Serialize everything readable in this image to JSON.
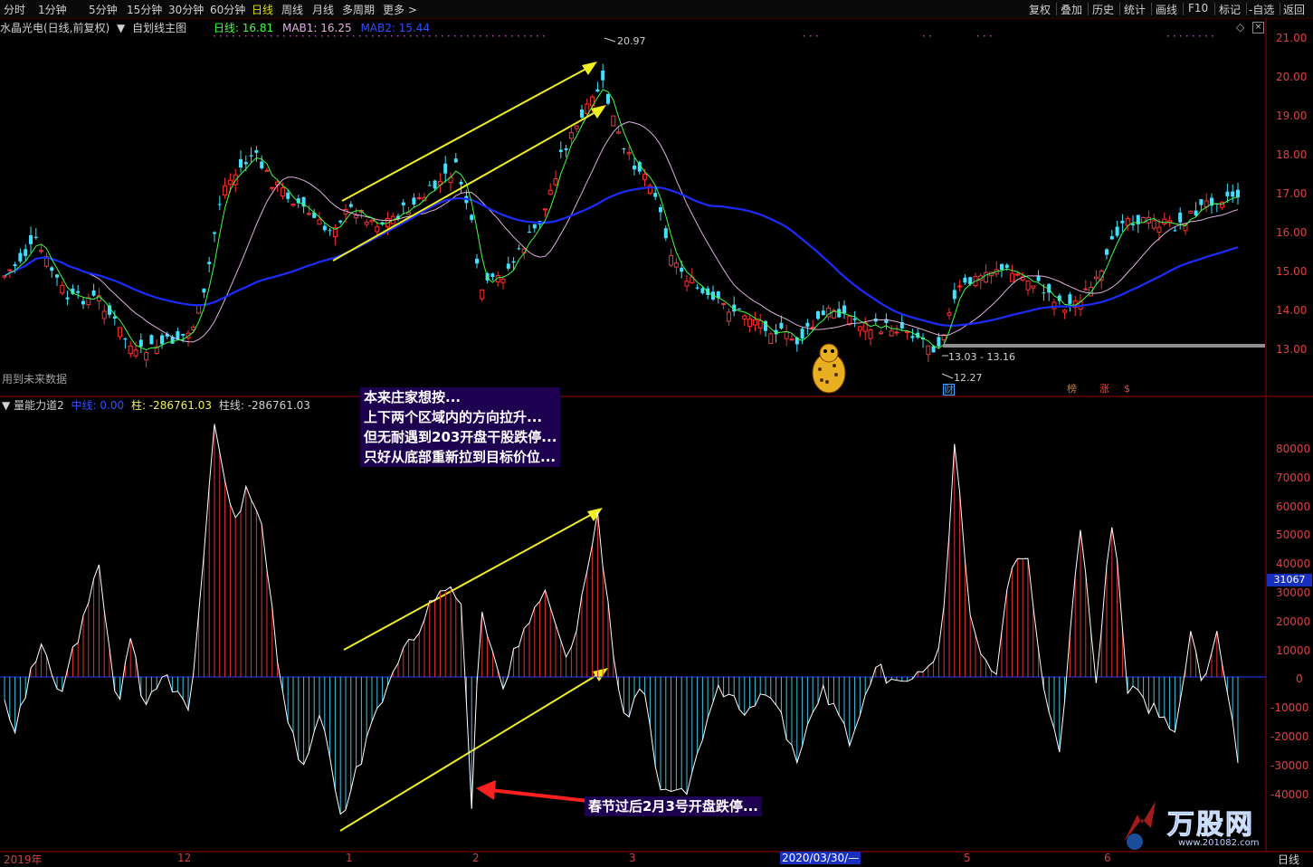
{
  "toolbar": {
    "periods": [
      "分时",
      "1分钟",
      "5分钟",
      "15分钟",
      "30分钟",
      "60分钟",
      "日线",
      "周线",
      "月线",
      "多周期",
      "更多 >"
    ],
    "active_index": 6,
    "right_buttons": [
      "复权",
      "叠加",
      "历史",
      "统计",
      "画线",
      "F10",
      "标记",
      "-自选",
      "返回"
    ]
  },
  "main_chart": {
    "stock_title": "水晶光电(日线,前复权)",
    "indicator_selector": "自划线主图",
    "legend": {
      "day_label": "日线: 16.81",
      "mab1_label": "MAB1: 16.25",
      "mab2_label": "MAB2: 15.44"
    },
    "future_data_label": "用到未来数据",
    "high_label": "20.97",
    "low_label": "12.27",
    "range_label": "13.03 - 13.16",
    "y_ticks": [
      "21.00",
      "20.00",
      "19.00",
      "18.00",
      "17.00",
      "16.00",
      "15.00",
      "14.00",
      "13.00"
    ],
    "markers": {
      "cai": "财",
      "bang": "榜",
      "zhang": "涨",
      "s": "$"
    }
  },
  "sub_chart": {
    "indicator_name": "量能力道2",
    "zhongxian_label": "中线: 0.00",
    "zhu_label": "柱: -286761.03",
    "zhuxian_label": "柱线: -286761.03",
    "y_ticks": [
      "80000",
      "70000",
      "60000",
      "50000",
      "40000",
      "30000",
      "20000",
      "10000",
      "0",
      "-10000",
      "-20000",
      "-30000",
      "-40000"
    ],
    "current_value": "31067"
  },
  "annotations": {
    "lines": [
      "本来庄家想按...",
      "上下两个区域内的方向拉升...",
      "但无耐遇到203开盘干股跌停...",
      "只好从底部重新拉到目标价位..."
    ],
    "bottom_note": "春节过后2月3号开盘跌停..."
  },
  "x_axis": {
    "labels": [
      "2019年",
      "12",
      "1",
      "2",
      "3",
      "2020/03/30/—",
      "5",
      "6"
    ],
    "period_label": "日线"
  },
  "watermark": {
    "brand": "万股网",
    "url": "www.201082.com"
  },
  "colors": {
    "up": "#ff3030",
    "down": "#40e0ff",
    "ma_blue": "#1c2cff",
    "ma_pink": "#e0b0e0",
    "ma_green": "#40ff40",
    "trend": "#f0f020"
  }
}
